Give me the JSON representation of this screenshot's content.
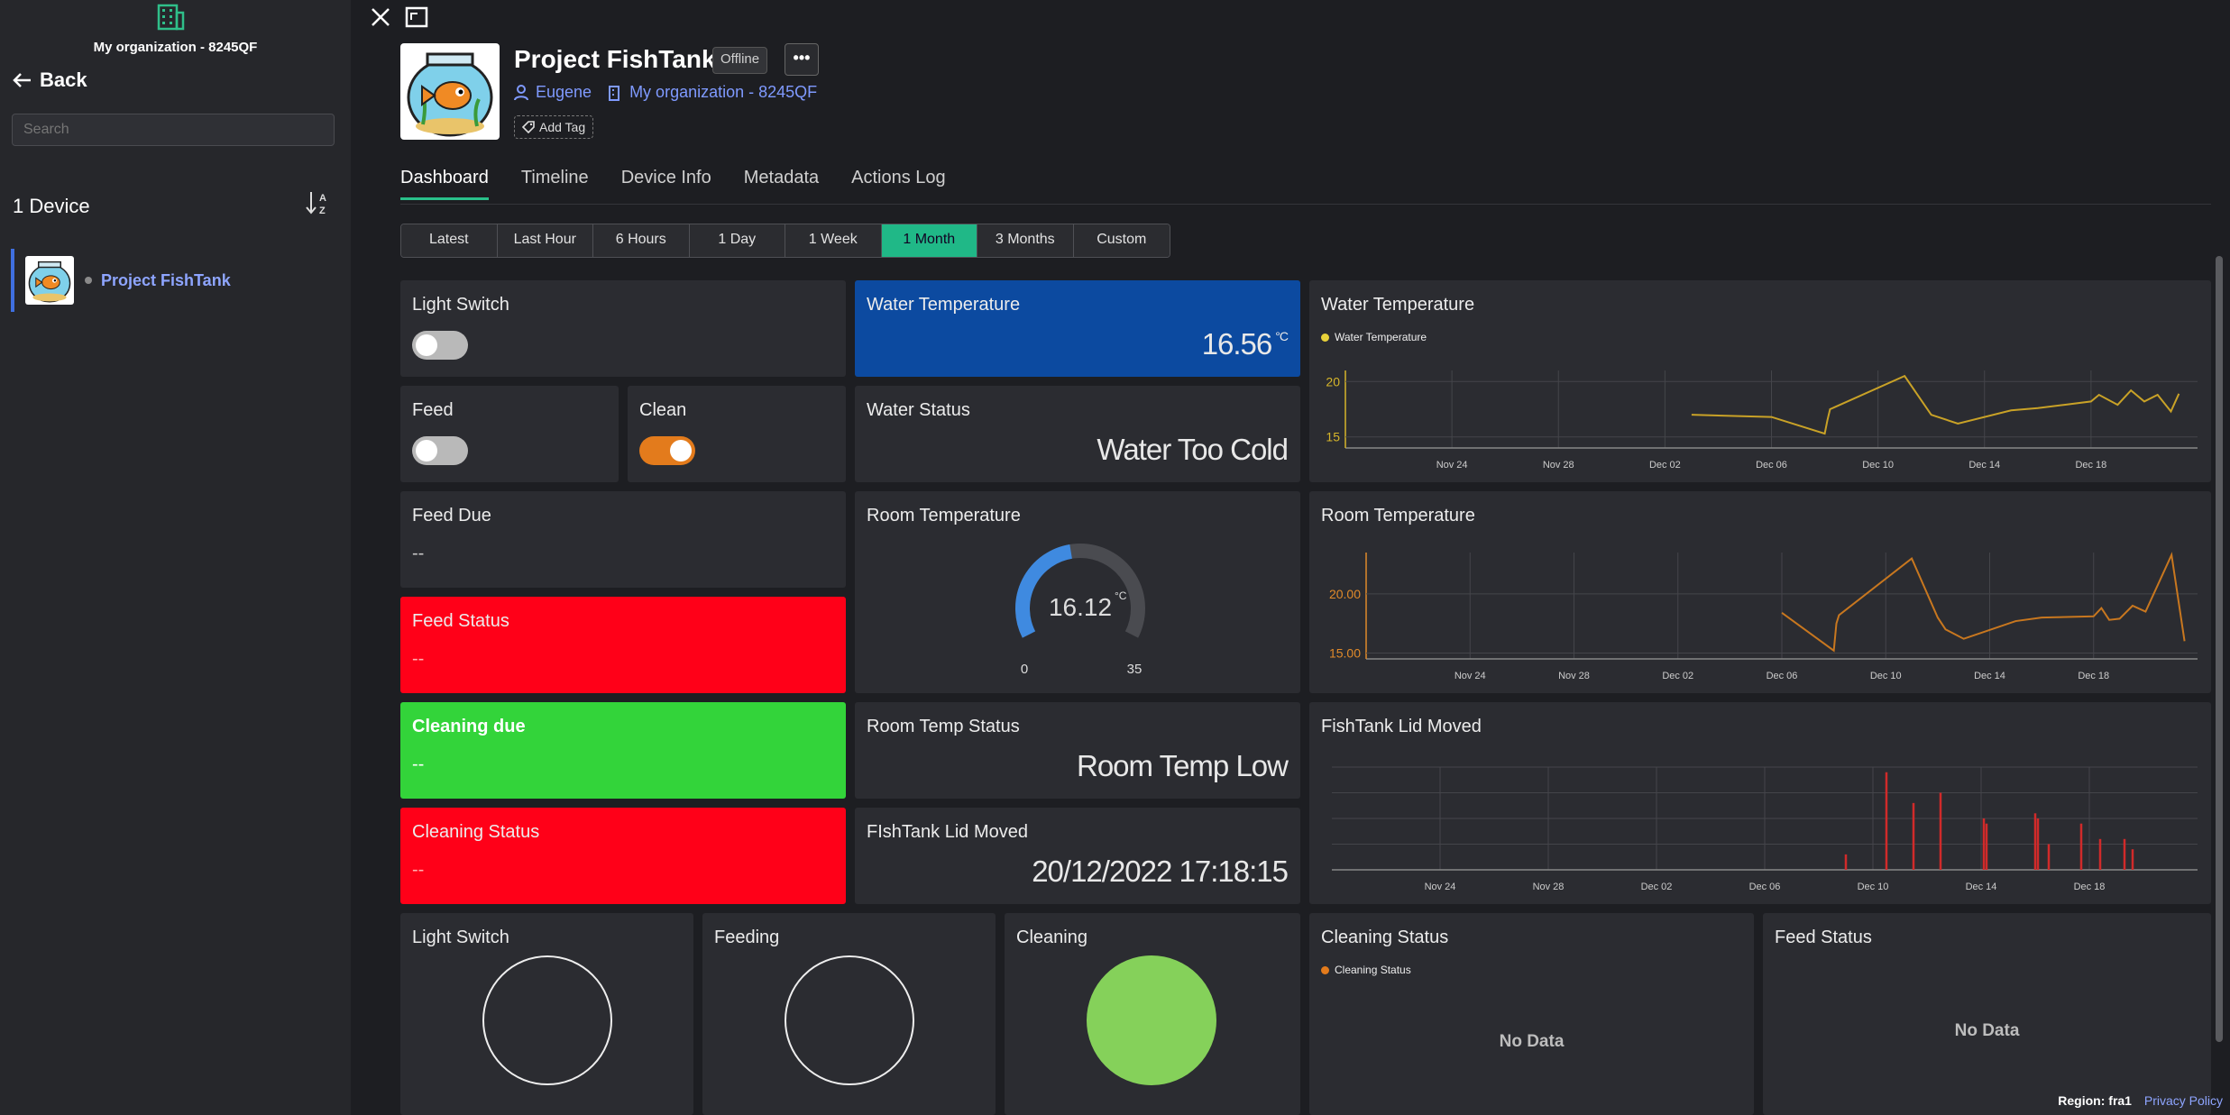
{
  "sidebar": {
    "org_name": "My organization - 8245QF",
    "back_label": "Back",
    "search_placeholder": "Search",
    "device_count": "1 Device",
    "devices": [
      {
        "name": "Project FishTank",
        "status_color": "#8a8a8a"
      }
    ]
  },
  "header": {
    "title": "Project FishTank",
    "status": "Offline",
    "more_label": "•••",
    "owner": "Eugene",
    "organization": "My organization - 8245QF",
    "add_tag": "Add Tag"
  },
  "tabs": [
    "Dashboard",
    "Timeline",
    "Device Info",
    "Metadata",
    "Actions Log"
  ],
  "active_tab": "Dashboard",
  "time_ranges": [
    "Latest",
    "Last Hour",
    "6 Hours",
    "1 Day",
    "1 Week",
    "1 Month",
    "3 Months",
    "Custom"
  ],
  "active_range": "1 Month",
  "widgets": {
    "light_switch": {
      "title": "Light Switch",
      "on": false
    },
    "feed": {
      "title": "Feed",
      "on": false
    },
    "clean": {
      "title": "Clean",
      "on": true
    },
    "feed_due": {
      "title": "Feed Due",
      "value": "--"
    },
    "feed_status": {
      "title": "Feed Status",
      "value": "--",
      "color": "#ff0018"
    },
    "cleaning_due": {
      "title": "Cleaning due",
      "value": "--",
      "color": "#33d43a"
    },
    "cleaning_status": {
      "title": "Cleaning Status",
      "value": "--",
      "color": "#ff0018"
    },
    "water_temp": {
      "title": "Water Temperature",
      "value": "16.56",
      "unit": "°C",
      "color": "#0c4aa0"
    },
    "water_status": {
      "title": "Water Status",
      "value": "Water Too Cold"
    },
    "room_temp": {
      "title": "Room Temperature",
      "value": "16.12",
      "unit": "°C",
      "min": "0",
      "max": "35",
      "fraction": 0.46
    },
    "room_temp_status": {
      "title": "Room Temp Status",
      "value": "Room Temp Low"
    },
    "lid_moved": {
      "title": "FIshTank Lid Moved",
      "value": "20/12/2022 17:18:15"
    },
    "light_switch_led": {
      "title": "Light Switch",
      "on": false
    },
    "feeding_led": {
      "title": "Feeding",
      "on": false
    },
    "cleaning_led": {
      "title": "Cleaning",
      "on": true,
      "color": "#85d15a"
    },
    "cleaning_status_chart": {
      "title": "Cleaning Status",
      "legend": "Cleaning Status",
      "empty": "No Data",
      "color": "#e37b1c"
    },
    "feed_status_chart": {
      "title": "Feed Status",
      "empty": "No Data"
    }
  },
  "chart_data": [
    {
      "type": "line",
      "title": "Water Temperature",
      "series": [
        {
          "name": "Water Temperature",
          "color": "#c9a227",
          "x": [
            "Dec 03",
            "Dec 06",
            "Dec 08",
            "Dec 08.1",
            "Dec 08.2",
            "Dec 11",
            "Dec 12",
            "Dec 13",
            "Dec 15",
            "Dec 16",
            "Dec 17",
            "Dec 18",
            "Dec 18.3",
            "Dec 19",
            "Dec 19.5",
            "Dec 20",
            "Dec 20.5",
            "Dec 21",
            "Dec 21.3"
          ],
          "values": [
            17.0,
            16.8,
            15.3,
            16.5,
            17.5,
            20.5,
            17.0,
            16.2,
            17.4,
            17.6,
            17.9,
            18.2,
            18.8,
            17.9,
            19.2,
            18.2,
            18.8,
            17.3,
            18.9
          ]
        }
      ],
      "x_ticks": [
        "Nov 24",
        "Nov 28",
        "Dec 02",
        "Dec 06",
        "Dec 10",
        "Dec 14",
        "Dec 18"
      ],
      "y_ticks": [
        "15",
        "20"
      ],
      "ylim": [
        14,
        21
      ]
    },
    {
      "type": "line",
      "title": "Room Temperature",
      "series": [
        {
          "name": "Room Temperature",
          "color": "#c8771f",
          "x": [
            "Dec 06",
            "Dec 08",
            "Dec 08.1",
            "Dec 08.2",
            "Dec 11",
            "Dec 12",
            "Dec 12.3",
            "Dec 13",
            "Dec 15",
            "Dec 16",
            "Dec 18",
            "Dec 18.3",
            "Dec 18.6",
            "Dec 19",
            "Dec 19.5",
            "Dec 20",
            "Dec 21",
            "Dec 21.5"
          ],
          "values": [
            18.4,
            15.2,
            17.5,
            18.2,
            23.0,
            18.0,
            17.0,
            16.2,
            17.7,
            18.0,
            18.1,
            18.8,
            17.8,
            17.9,
            19.0,
            18.5,
            23.3,
            16.0
          ]
        }
      ],
      "x_ticks": [
        "Nov 24",
        "Nov 28",
        "Dec 02",
        "Dec 06",
        "Dec 10",
        "Dec 14",
        "Dec 18"
      ],
      "y_ticks": [
        "15.00",
        "20.00"
      ],
      "ylim": [
        14.5,
        23.5
      ]
    },
    {
      "type": "bar",
      "title": "FishTank Lid Moved",
      "series": [
        {
          "name": "FishTank Lid Moved",
          "color": "#d12a2a",
          "x": [
            9.0,
            10.5,
            11.5,
            12.5,
            14.1,
            14.2,
            16.0,
            16.1,
            16.5,
            17.7,
            18.4,
            19.3,
            19.6
          ],
          "values": [
            0.15,
            0.95,
            0.65,
            0.75,
            0.5,
            0.45,
            0.55,
            0.5,
            0.25,
            0.45,
            0.3,
            0.3,
            0.2
          ]
        }
      ],
      "x_ticks": [
        "Nov 24",
        "Nov 28",
        "Dec 02",
        "Dec 06",
        "Dec 10",
        "Dec 14",
        "Dec 18"
      ],
      "ylim": [
        0,
        1
      ]
    }
  ],
  "footer": {
    "region_label": "Region:",
    "region": "fra1",
    "privacy": "Privacy Policy"
  }
}
